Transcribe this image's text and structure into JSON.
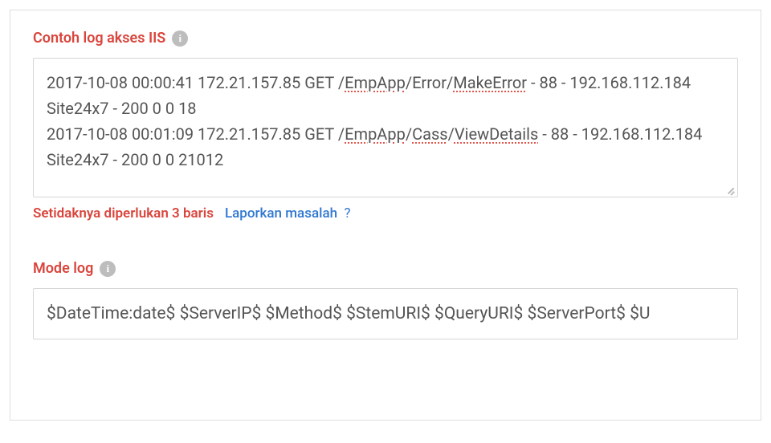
{
  "section1": {
    "label": "Contoh log akses IIS",
    "log_line1_prefix": "2017-10-08 00:00:41 172.21.157.85 GET /",
    "log_line1_part1": "EmpApp",
    "log_line1_sep1": "/Error/",
    "log_line1_part2": "MakeError",
    "log_line1_suffix": " - 88 - 192.168.112.184 Site24x7 - 200 0 0 18",
    "log_line2_prefix": "2017-10-08 00:01:09 172.21.157.85 GET /",
    "log_line2_part1": "EmpApp",
    "log_line2_sep1": "/",
    "log_line2_part2": "Cass",
    "log_line2_sep2": "/",
    "log_line2_part3": "ViewDetails",
    "log_line2_suffix": " - 88 - 192.168.112.184 Site24x7 - 200 0 0 21012"
  },
  "validation": {
    "error_text": "Setidaknya diperlukan 3 baris",
    "report_text": "Laporkan masalah",
    "help_symbol": "?"
  },
  "section2": {
    "label": "Mode log",
    "value": "$DateTime:date$ $ServerIP$ $Method$ $StemURI$ $QueryURI$ $ServerPort$ $U"
  }
}
